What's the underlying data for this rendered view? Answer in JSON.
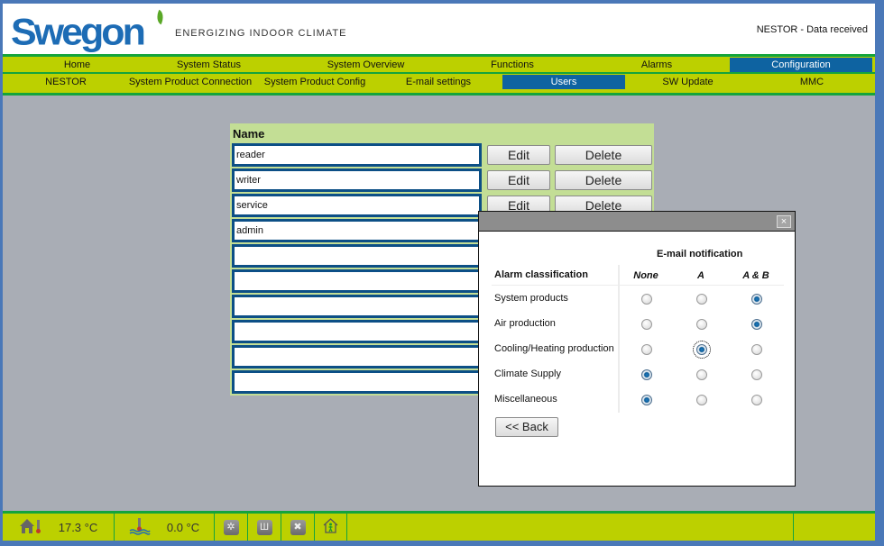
{
  "header": {
    "logo_text": "Swegon",
    "tagline": "ENERGIZING INDOOR CLIMATE",
    "status": "NESTOR - Data received"
  },
  "nav_main": [
    {
      "label": "Home",
      "active": false
    },
    {
      "label": "System Status",
      "active": false
    },
    {
      "label": "System Overview",
      "active": false
    },
    {
      "label": "Functions",
      "active": false
    },
    {
      "label": "Alarms",
      "active": false
    },
    {
      "label": "Configuration",
      "active": true
    }
  ],
  "nav_sub": [
    {
      "label": "NESTOR",
      "active": false
    },
    {
      "label": "System Product Connection",
      "active": false
    },
    {
      "label": "System Product Config",
      "active": false
    },
    {
      "label": "E-mail settings",
      "active": false
    },
    {
      "label": "Users",
      "active": true
    },
    {
      "label": "SW Update",
      "active": false
    },
    {
      "label": "MMC",
      "active": false
    }
  ],
  "users": {
    "header": "Name",
    "edit_label": "Edit",
    "delete_label": "Delete",
    "rows": [
      "reader",
      "writer",
      "service",
      "admin",
      "",
      "",
      "",
      "",
      "",
      ""
    ]
  },
  "dialog": {
    "close_icon": "×",
    "email_heading": "E-mail notification",
    "class_heading": "Alarm classification",
    "columns": [
      "None",
      "A",
      "A & B"
    ],
    "rows": [
      {
        "label": "System products",
        "selected": "A & B"
      },
      {
        "label": "Air production",
        "selected": "A & B"
      },
      {
        "label": "Cooling/Heating production",
        "selected": "A"
      },
      {
        "label": "Climate Supply",
        "selected": "None"
      },
      {
        "label": "Miscellaneous",
        "selected": "None"
      }
    ],
    "focused_row": 2,
    "back_label": "<< Back"
  },
  "footer": {
    "indoor_temp": "17.3 °C",
    "water_temp": "0.0 °C",
    "icons": [
      "cooling-icon",
      "heating-icon",
      "off-icon",
      "occupancy-icon"
    ]
  },
  "colors": {
    "brand_blue": "#1d6cb5",
    "nav_green": "#bcd000",
    "nav_border": "#14a43c",
    "active_blue": "#0e63a1",
    "panel_green": "#c3de95"
  }
}
